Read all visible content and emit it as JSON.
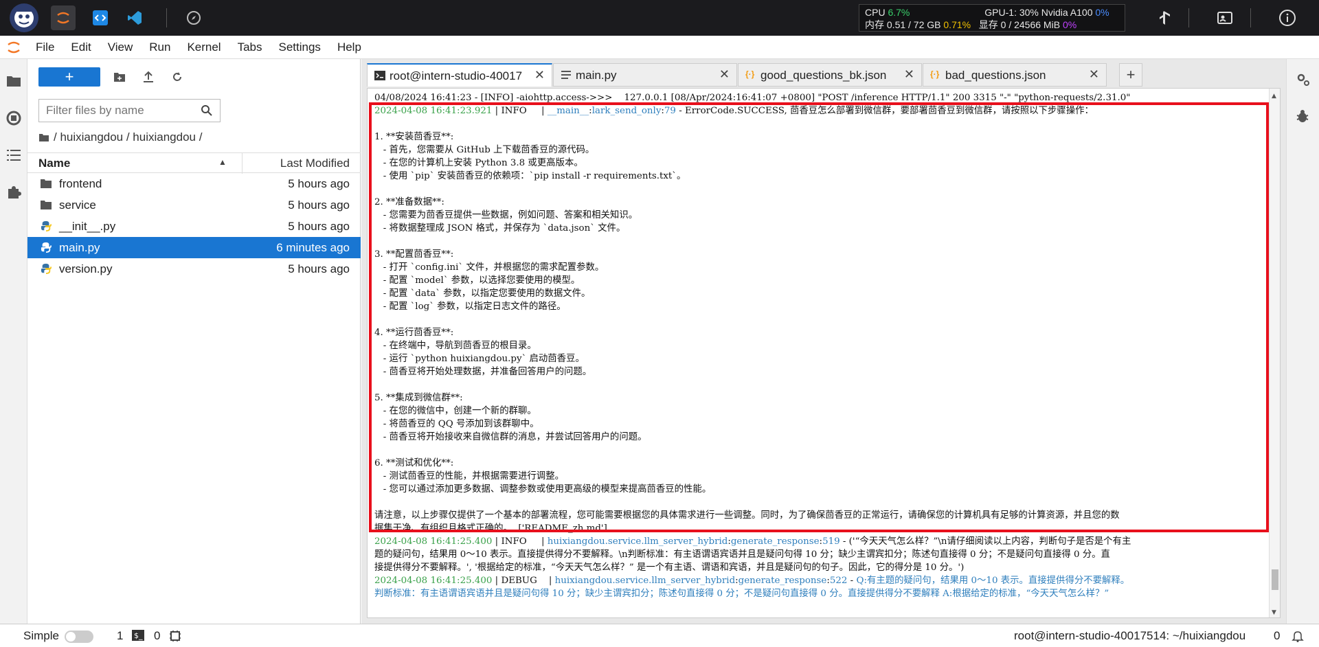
{
  "topbar": {
    "stats": {
      "cpu_label": "CPU",
      "cpu_value": "6.7%",
      "mem_label": "内存 0.51 / 72 GB",
      "mem_value": "0.71%",
      "gpu_label": "GPU-1: 30% Nvidia A100",
      "gpu_value": "0%",
      "vram_label": "显存 0 / 24566 MiB",
      "vram_value": "0%"
    }
  },
  "menubar": {
    "items": [
      "File",
      "Edit",
      "View",
      "Run",
      "Kernel",
      "Tabs",
      "Settings",
      "Help"
    ]
  },
  "filebrowser": {
    "new_label": "+",
    "filter_placeholder": "Filter files by name",
    "breadcrumb": "/ huixiangdou / huixiangdou /",
    "col_name": "Name",
    "col_modified": "Last Modified",
    "files": [
      {
        "name": "frontend",
        "type": "folder",
        "modified": "5 hours ago",
        "selected": false
      },
      {
        "name": "service",
        "type": "folder",
        "modified": "5 hours ago",
        "selected": false
      },
      {
        "name": "__init__.py",
        "type": "python",
        "modified": "5 hours ago",
        "selected": false
      },
      {
        "name": "main.py",
        "type": "python",
        "modified": "6 minutes ago",
        "selected": true
      },
      {
        "name": "version.py",
        "type": "python",
        "modified": "5 hours ago",
        "selected": false
      }
    ]
  },
  "tabs": [
    {
      "label": "root@intern-studio-40017",
      "icon": "terminal-icon",
      "active": true
    },
    {
      "label": "main.py",
      "icon": "file-icon",
      "active": false
    },
    {
      "label": "good_questions_bk.json",
      "icon": "json-icon",
      "active": false
    },
    {
      "label": "bad_questions.json",
      "icon": "json-icon",
      "active": false
    }
  ],
  "terminal": {
    "lines": [
      {
        "text": "04/08/2024 16:41:23 - [INFO] -aiohttp.access->>>    127.0.0.1 [08/Apr/2024:16:41:07 +0800] \"POST /inference HTTP/1.1\" 200 3315 \"-\" \"python-requests/2.31.0\""
      },
      {
        "ts": "2024-04-08 16:41:23.921",
        "level": "INFO    ",
        "module": "__main__",
        "func": "lark_send_only",
        "lineno": "79",
        "msg": "ErrorCode.SUCCESS, 茴香豆怎么部署到微信群，要部署茴香豆到微信群，请按照以下步骤操作："
      },
      {
        "text": ""
      },
      {
        "text": "1. **安装茴香豆**:"
      },
      {
        "text": "   - 首先，您需要从 GitHub 上下载茴香豆的源代码。"
      },
      {
        "text": "   - 在您的计算机上安装 Python 3.8 或更高版本。"
      },
      {
        "text": "   - 使用 `pip` 安装茴香豆的依赖项：`pip install -r requirements.txt`。"
      },
      {
        "text": ""
      },
      {
        "text": "2. **准备数据**:"
      },
      {
        "text": "   - 您需要为茴香豆提供一些数据，例如问题、答案和相关知识。"
      },
      {
        "text": "   - 将数据整理成 JSON 格式，并保存为 `data.json` 文件。"
      },
      {
        "text": ""
      },
      {
        "text": "3. **配置茴香豆**:"
      },
      {
        "text": "   - 打开 `config.ini` 文件，并根据您的需求配置参数。"
      },
      {
        "text": "   - 配置 `model` 参数，以选择您要使用的模型。"
      },
      {
        "text": "   - 配置 `data` 参数，以指定您要使用的数据文件。"
      },
      {
        "text": "   - 配置 `log` 参数，以指定日志文件的路径。"
      },
      {
        "text": ""
      },
      {
        "text": "4. **运行茴香豆**:"
      },
      {
        "text": "   - 在终端中，导航到茴香豆的根目录。"
      },
      {
        "text": "   - 运行 `python huixiangdou.py` 启动茴香豆。"
      },
      {
        "text": "   - 茴香豆将开始处理数据，并准备回答用户的问题。"
      },
      {
        "text": ""
      },
      {
        "text": "5. **集成到微信群**:"
      },
      {
        "text": "   - 在您的微信中，创建一个新的群聊。"
      },
      {
        "text": "   - 将茴香豆的 QQ 号添加到该群聊中。"
      },
      {
        "text": "   - 茴香豆将开始接收来自微信群的消息，并尝试回答用户的问题。"
      },
      {
        "text": ""
      },
      {
        "text": "6. **测试和优化**:"
      },
      {
        "text": "   - 测试茴香豆的性能，并根据需要进行调整。"
      },
      {
        "text": "   - 您可以通过添加更多数据、调整参数或使用更高级的模型来提高茴香豆的性能。"
      },
      {
        "text": ""
      },
      {
        "text": "请注意，以上步骤仅提供了一个基本的部署流程，您可能需要根据您的具体需求进行一些调整。同时，为了确保茴香豆的正常运行，请确保您的计算机具有足够的计算资源，并且您的数"
      },
      {
        "text": "据集干净、有组织且格式正确的。, ['README_zh.md']"
      },
      {
        "ts": "2024-04-08 16:41:25.400",
        "level": "INFO    ",
        "module": "huixiangdou.service.llm_server_hybrid",
        "func": "generate_response",
        "lineno": "519",
        "msg": "('“今天天气怎么样？”\\n请仔细阅读以上内容，判断句子是否是个有主"
      },
      {
        "text": "题的疑问句，结果用 0～10 表示。直接提供得分不要解释。\\n判断标准：有主语谓语宾语并且是疑问句得 10 分；缺少主谓宾扣分；陈述句直接得 0 分；不是疑问句直接得 0 分。直"
      },
      {
        "text": "接提供得分不要解释。', '根据给定的标准，“今天天气怎么样？” 是一个有主语、谓语和宾语，并且是疑问句的句子。因此，它的得分是 10 分。')"
      },
      {
        "ts": "2024-04-08 16:41:25.400",
        "level": "DEBUG   ",
        "module": "huixiangdou.service.llm_server_hybrid",
        "func": "generate_response",
        "lineno": "522",
        "msg": "Q:有主题的疑问句，结果用 0～10 表示。直接提供得分不要解释。",
        "debug": true
      },
      {
        "text": "判断标准：有主语谓语宾语并且是疑问句得 10 分；缺少主谓宾扣分；陈述句直接得 0 分；不是疑问句直接得 0 分。直接提供得分不要解释 A:根据给定的标准，“今天天气怎么样？”",
        "debug": true
      }
    ]
  },
  "statusbar": {
    "mode_label": "Simple",
    "terminals_count": "1",
    "kernels_count": "0",
    "path": "root@intern-studio-40017514: ~/huixiangdou",
    "right_count": "0"
  }
}
